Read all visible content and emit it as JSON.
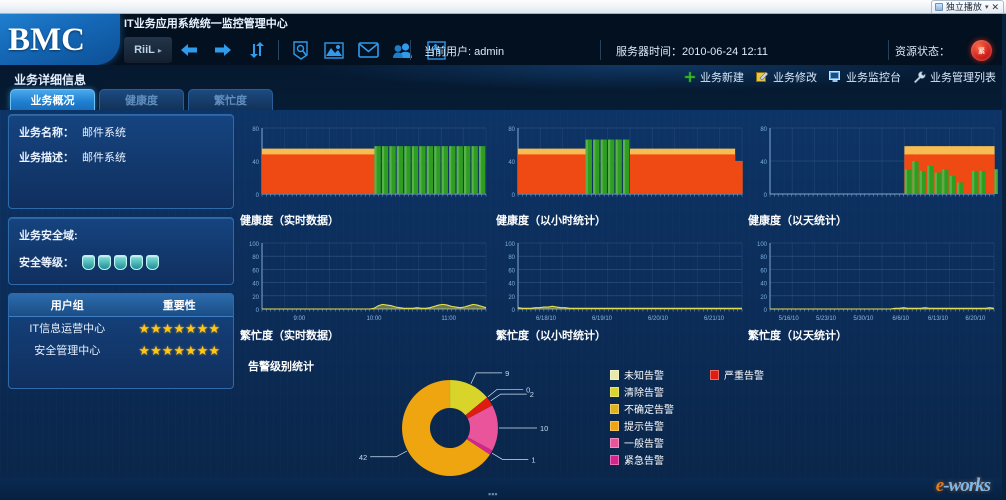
{
  "window": {
    "tab_label": "独立播放",
    "tab_icon": "media-icon",
    "caret": "▾",
    "close": "✕"
  },
  "header": {
    "brand": "BMC",
    "title": "IT业务应用系统统一监控管理中心",
    "toolbar": {
      "menu_label": "RiiL",
      "menu_caret": "▸",
      "icons": [
        {
          "name": "back-arrow-icon",
          "glyph": "⬅"
        },
        {
          "name": "forward-arrow-icon",
          "glyph": "➡"
        },
        {
          "name": "refresh-icon",
          "glyph": "⇅"
        },
        {
          "name": "search-tool-icon",
          "glyph": "◌"
        },
        {
          "name": "image-report-icon",
          "glyph": "▨"
        },
        {
          "name": "mail-icon",
          "glyph": "✉"
        },
        {
          "name": "users-icon",
          "glyph": "👥"
        },
        {
          "name": "exit-icon",
          "glyph": "🚶"
        }
      ]
    },
    "current_user_label": "当前用户: admin",
    "server_time_label": "服务器时间：2010-06-24 12:11",
    "resource_status_label": "资源状态：",
    "resource_status_badge": "紧",
    "resource_status_color": "#c81010"
  },
  "subbar": {
    "page_title": "业务详细信息",
    "actions": [
      {
        "name": "business-create",
        "icon": "plus-icon",
        "label": "业务新建"
      },
      {
        "name": "business-edit",
        "icon": "edit-icon",
        "label": "业务修改"
      },
      {
        "name": "business-console",
        "icon": "monitor-icon",
        "label": "业务监控台"
      },
      {
        "name": "business-manage-list",
        "icon": "wrench-icon",
        "label": "业务管理列表"
      }
    ],
    "tabs": [
      {
        "label": "业务概况",
        "active": true
      },
      {
        "label": "健康度",
        "active": false
      },
      {
        "label": "繁忙度",
        "active": false
      }
    ]
  },
  "left_panel": {
    "info": [
      {
        "label": "业务名称：",
        "value": "邮件系统"
      },
      {
        "label": "业务描述：",
        "value": "邮件系统"
      }
    ],
    "security": {
      "domain_label": "业务安全域:",
      "level_label": "安全等级：",
      "level_count": 5
    },
    "table": {
      "headers": [
        "用户组",
        "重要性"
      ],
      "rows": [
        {
          "group": "IT信息运营中心",
          "stars": 7
        },
        {
          "group": "安全管理中心",
          "stars": 7
        }
      ],
      "star_color": "#ffc61a"
    }
  },
  "chart_data": [
    {
      "id": "health-realtime",
      "type": "area",
      "title": "健康度（实时数据）",
      "ylabel": "",
      "xlabel": "",
      "ylim": [
        0,
        80
      ],
      "yticks": [
        0,
        40,
        80
      ],
      "grid": true,
      "xticks": [
        "",
        "",
        "",
        ""
      ],
      "series": [
        {
          "name": "red-band",
          "color": "#f04a14",
          "values": [
            48,
            48,
            48,
            48,
            48,
            48,
            48,
            48,
            48,
            48,
            48,
            48,
            48,
            48,
            48,
            0,
            0,
            0,
            0,
            0,
            0,
            0,
            0,
            0,
            0,
            0,
            0,
            0,
            0,
            0
          ]
        },
        {
          "name": "orange-band",
          "color": "#f7bc52",
          "values": [
            55,
            55,
            55,
            55,
            55,
            55,
            55,
            55,
            55,
            55,
            55,
            55,
            55,
            55,
            55,
            0,
            0,
            0,
            0,
            0,
            0,
            0,
            0,
            0,
            0,
            0,
            0,
            0,
            0,
            0
          ]
        },
        {
          "name": "green-bars",
          "color": "#2f9e20",
          "values": [
            0,
            0,
            0,
            0,
            0,
            0,
            0,
            0,
            0,
            0,
            0,
            0,
            0,
            0,
            0,
            58,
            58,
            58,
            58,
            58,
            58,
            58,
            58,
            58,
            58,
            58,
            58,
            58,
            58,
            58
          ]
        }
      ]
    },
    {
      "id": "health-hourly",
      "type": "area",
      "title": "健康度（以小时统计）",
      "ylim": [
        0,
        80
      ],
      "yticks": [
        0,
        40,
        80
      ],
      "grid": true,
      "xticks": [
        "",
        "",
        "",
        ""
      ],
      "series": [
        {
          "name": "red-band",
          "color": "#f04a14",
          "values": [
            48,
            48,
            48,
            48,
            48,
            48,
            48,
            48,
            48,
            0,
            0,
            0,
            0,
            0,
            0,
            48,
            48,
            48,
            48,
            48,
            48,
            48,
            48,
            48,
            48,
            48,
            48,
            48,
            48,
            40
          ]
        },
        {
          "name": "orange-band",
          "color": "#f7bc52",
          "values": [
            55,
            55,
            55,
            55,
            55,
            55,
            55,
            55,
            55,
            0,
            0,
            0,
            0,
            0,
            0,
            55,
            55,
            55,
            55,
            55,
            55,
            55,
            55,
            55,
            55,
            55,
            55,
            55,
            55,
            40
          ]
        },
        {
          "name": "green-bars",
          "color": "#2f9e20",
          "values": [
            0,
            0,
            0,
            0,
            0,
            0,
            0,
            0,
            0,
            66,
            66,
            66,
            66,
            66,
            66,
            0,
            0,
            0,
            0,
            0,
            0,
            0,
            0,
            0,
            0,
            0,
            0,
            0,
            0,
            0
          ]
        }
      ]
    },
    {
      "id": "health-daily",
      "type": "area",
      "title": "健康度（以天统计）",
      "ylim": [
        0,
        80
      ],
      "yticks": [
        0,
        40,
        80
      ],
      "grid": true,
      "xticks": [
        "",
        "",
        "",
        ""
      ],
      "series": [
        {
          "name": "red-band",
          "color": "#f04a14",
          "values": [
            0,
            0,
            0,
            0,
            0,
            0,
            0,
            0,
            0,
            0,
            0,
            0,
            0,
            0,
            0,
            0,
            0,
            0,
            48,
            48,
            48,
            48,
            48,
            48,
            48,
            48,
            48,
            48,
            48,
            48
          ]
        },
        {
          "name": "orange-band",
          "color": "#f7bc52",
          "values": [
            0,
            0,
            0,
            0,
            0,
            0,
            0,
            0,
            0,
            0,
            0,
            0,
            0,
            0,
            0,
            0,
            0,
            0,
            58,
            58,
            58,
            58,
            58,
            58,
            58,
            58,
            58,
            58,
            58,
            58
          ]
        },
        {
          "name": "green-bars",
          "color": "#2f9e20",
          "values": [
            0,
            0,
            0,
            0,
            0,
            0,
            0,
            0,
            0,
            0,
            0,
            0,
            0,
            0,
            0,
            0,
            0,
            0,
            30,
            40,
            28,
            34,
            26,
            30,
            22,
            14,
            0,
            28,
            28,
            0,
            30,
            32
          ]
        }
      ]
    },
    {
      "id": "busy-realtime",
      "type": "line",
      "title": "繁忙度（实时数据）",
      "ylim": [
        0,
        100
      ],
      "yticks": [
        0,
        20,
        40,
        60,
        80,
        100
      ],
      "grid": true,
      "xticks": [
        "9:00",
        "10:00",
        "11:00"
      ],
      "line_color": "#e8e04a",
      "series": [
        {
          "name": "busy",
          "values": [
            0,
            0,
            0,
            0,
            0,
            0,
            0,
            0,
            0,
            0,
            0,
            0,
            0,
            0,
            0,
            0,
            0,
            0,
            0,
            0,
            0,
            0,
            0,
            0,
            0,
            0,
            1,
            5,
            7,
            6,
            5,
            3,
            2,
            1,
            1,
            1,
            2,
            1,
            1,
            2,
            4,
            6,
            7,
            6,
            4,
            3,
            2,
            3,
            5,
            7,
            6,
            4,
            2
          ]
        }
      ]
    },
    {
      "id": "busy-hourly",
      "type": "line",
      "title": "繁忙度（以小时统计）",
      "ylim": [
        0,
        100
      ],
      "yticks": [
        0,
        20,
        40,
        60,
        80,
        100
      ],
      "grid": true,
      "xticks": [
        "6/18/10",
        "6/19/10",
        "6/20/10",
        "6/21/10"
      ],
      "line_color": "#e8e04a",
      "series": [
        {
          "name": "busy",
          "values": [
            2,
            1,
            1,
            1,
            2,
            2,
            3,
            3,
            4,
            3,
            2,
            2,
            1,
            1,
            1,
            1,
            1,
            1,
            1,
            1,
            1,
            1,
            1,
            1,
            1,
            1,
            1,
            1,
            1,
            1,
            1,
            1,
            1,
            1,
            1,
            1,
            1,
            1,
            1,
            1,
            1,
            1,
            1,
            1,
            1,
            1,
            1,
            1,
            1,
            1,
            1,
            1,
            1
          ]
        }
      ]
    },
    {
      "id": "busy-daily",
      "type": "line",
      "title": "繁忙度（以天统计）",
      "ylim": [
        0,
        100
      ],
      "yticks": [
        0,
        20,
        40,
        60,
        80,
        100
      ],
      "grid": true,
      "xticks": [
        "5/16/10",
        "5/23/10",
        "5/30/10",
        "6/6/10",
        "6/13/10",
        "6/20/10"
      ],
      "line_color": "#e8e04a",
      "series": [
        {
          "name": "busy",
          "values": [
            0,
            0,
            0,
            0,
            0,
            0,
            0,
            0,
            0,
            0,
            0,
            0,
            0,
            0,
            0,
            0,
            0,
            0,
            0,
            0,
            0,
            0,
            0,
            0,
            0,
            0,
            0,
            0,
            0,
            1,
            1,
            2,
            1,
            1,
            1,
            1,
            2,
            1,
            1,
            1,
            1,
            1,
            1,
            1,
            1,
            1,
            1,
            1,
            1,
            1,
            1,
            2,
            1
          ]
        }
      ]
    },
    {
      "id": "alarm-level-pie",
      "type": "pie",
      "title": "告警级别统计",
      "labels": [
        "未知告警",
        "清除告警",
        "不确定告警",
        "提示告警",
        "一般告警",
        "紧急告警",
        "严重告警"
      ],
      "slices": [
        {
          "label": "清除告警",
          "value": 9,
          "color": "#d9d42a",
          "callout": "9"
        },
        {
          "label": "未知告警",
          "value": 0,
          "color": "#e8eaa8",
          "callout": "0"
        },
        {
          "label": "严重告警",
          "value": 2,
          "color": "#e01b10",
          "callout": "2"
        },
        {
          "label": "一般告警",
          "value": 10,
          "color": "#e9549a",
          "callout": "10"
        },
        {
          "label": "紧急告警",
          "value": 1,
          "color": "#d6258f",
          "callout": "1"
        },
        {
          "label": "提示告警",
          "value": 42,
          "color": "#efa510",
          "callout": "42"
        }
      ],
      "legend": {
        "position": "right",
        "col1": [
          {
            "label": "未知告警",
            "color": "#e8eaa8"
          },
          {
            "label": "清除告警",
            "color": "#d9d42a"
          },
          {
            "label": "不确定告警",
            "color": "#e0b21c"
          },
          {
            "label": "提示告警",
            "color": "#efa510"
          },
          {
            "label": "一般告警",
            "color": "#e9549a"
          },
          {
            "label": "紧急告警",
            "color": "#d6258f"
          }
        ],
        "col2": [
          {
            "label": "严重告警",
            "color": "#e01b10"
          }
        ]
      }
    }
  ],
  "footer": {
    "watermark": "e-works",
    "scroll_hint": "▪▪▪"
  }
}
